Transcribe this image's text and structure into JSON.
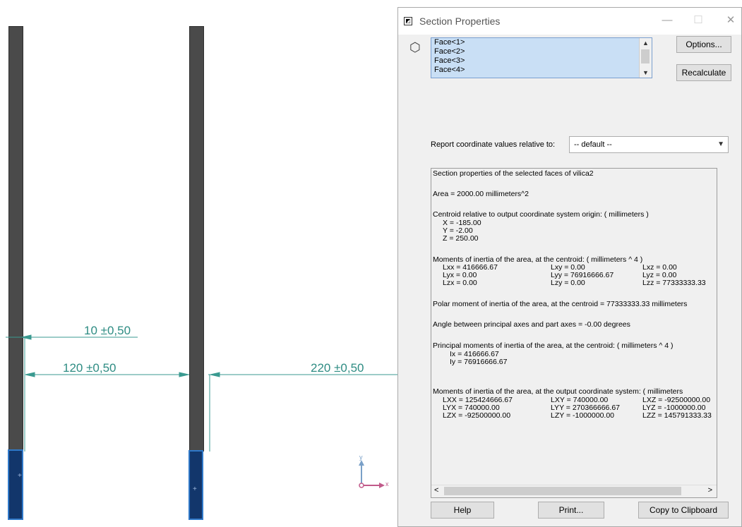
{
  "viewport": {
    "dims": [
      {
        "label": "10 ±0,50"
      },
      {
        "label": "120 ±0,50"
      },
      {
        "label": "220 ±0,50"
      }
    ],
    "triad": {
      "y_label": "y",
      "x_label": "x"
    }
  },
  "dialog": {
    "title": "Section Properties",
    "window_buttons": {
      "minimize": "—",
      "maximize": "☐",
      "close": "✕"
    },
    "faces": [
      "Face<1>",
      "Face<2>",
      "Face<3>",
      "Face<4>"
    ],
    "options_label": "Options...",
    "recalculate_label": "Recalculate",
    "report_label": "Report coordinate values relative to:",
    "report_value": "-- default --",
    "results": {
      "header": "Section properties of the selected faces of vilica2",
      "area": "Area = 2000.00 millimeters^2",
      "centroid_title": "Centroid relative to output coordinate system origin: ( millimeters )",
      "centroid": [
        "X = -185.00",
        "Y = -2.00",
        "Z = 250.00"
      ],
      "moi_title": "Moments of inertia of the area, at the centroid: ( millimeters ^ 4 )",
      "moi_rows": [
        [
          "Lxx = 416666.67",
          "Lxy = 0.00",
          "Lxz = 0.00"
        ],
        [
          "Lyx = 0.00",
          "Lyy = 76916666.67",
          "Lyz = 0.00"
        ],
        [
          "Lzx = 0.00",
          "Lzy = 0.00",
          "Lzz = 77333333.33"
        ]
      ],
      "polar": "Polar moment of inertia of the area, at the centroid = 77333333.33 millimeters",
      "angle": "Angle between principal axes and part axes = -0.00 degrees",
      "principal_title": "Principal moments of inertia of the area, at the centroid: ( millimeters ^ 4 )",
      "principal": [
        "Ix = 416666.67",
        "Iy = 76916666.67"
      ],
      "output_title": "Moments of inertia of the area, at the output coordinate system: ( millimeters",
      "output_rows": [
        [
          "LXX = 125424666.67",
          "LXY = 740000.00",
          "LXZ = -92500000.00"
        ],
        [
          "LYX = 740000.00",
          "LYY = 270366666.67",
          "LYZ = -1000000.00"
        ],
        [
          "LZX = -92500000.00",
          "LZY = -1000000.00",
          "LZZ = 145791333.33"
        ]
      ]
    },
    "help_label": "Help",
    "print_label": "Print...",
    "copy_label": "Copy to Clipboard"
  }
}
